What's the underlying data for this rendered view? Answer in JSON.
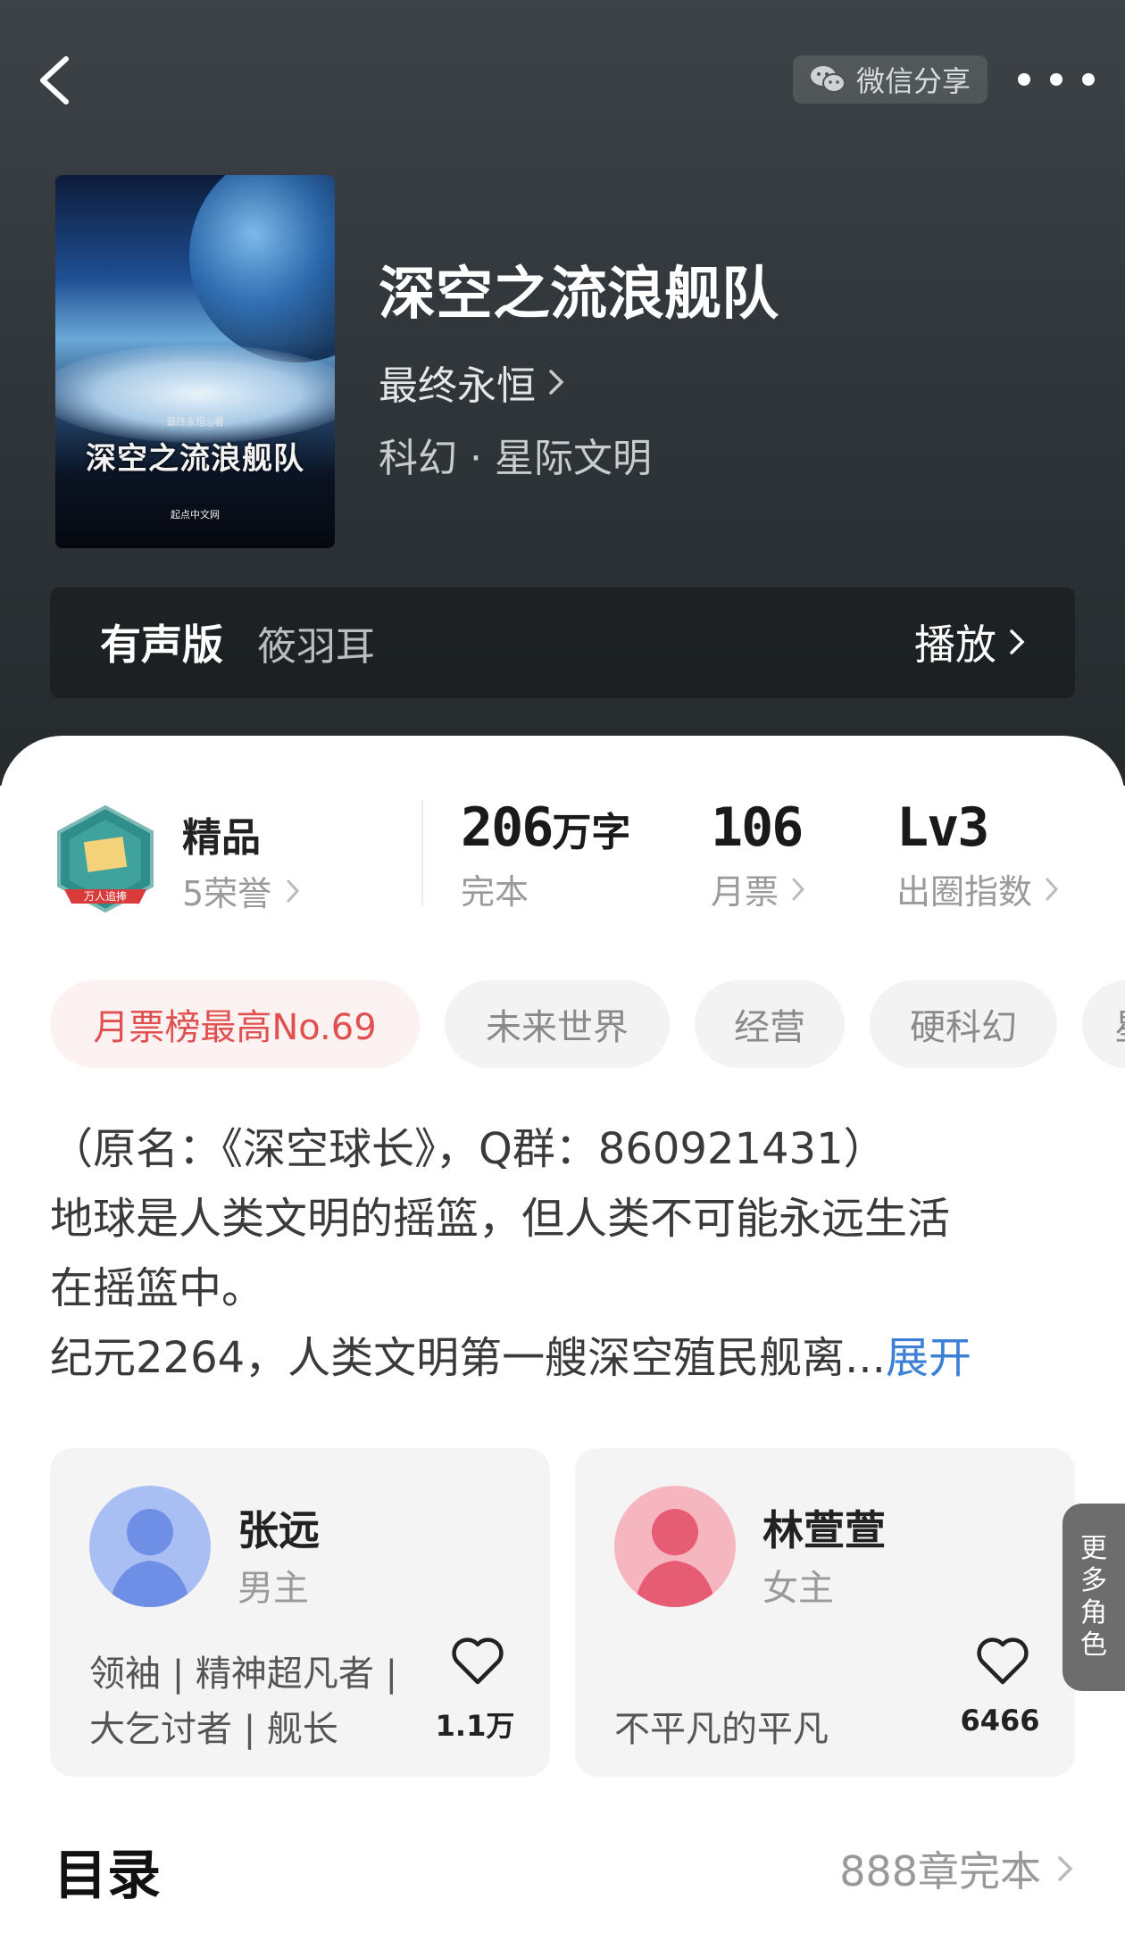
{
  "header": {
    "share_label": "微信分享",
    "icons": {
      "back": "back-arrow-icon",
      "wechat": "wechat-icon",
      "more": "more-icon"
    }
  },
  "book": {
    "title": "深空之流浪舰队",
    "author": "最终永恒",
    "genre": "科幻 · 星际文明",
    "cover_author": "最终永恒◎著",
    "cover_title": "深空之流浪舰队",
    "cover_publisher": "起点中文网"
  },
  "audio": {
    "label": "有声版",
    "narrator": "筱羽耳",
    "play_label": "播放"
  },
  "stats": {
    "quality": "精品",
    "honors": "5荣誉",
    "badge_text": "万人追捧",
    "words_num": "206",
    "words_unit": "万字",
    "status": "完本",
    "monthly_votes": "106",
    "monthly_votes_label": "月票",
    "level": "Lv3",
    "level_label": "出圈指数"
  },
  "tags": [
    "月票榜最高No.69",
    "未来世界",
    "经营",
    "硬科幻",
    "星"
  ],
  "description": {
    "line1": "（原名：《深空球长》，Q群：860921431）",
    "line2": "地球是人类文明的摇篮，但人类不可能永远生活",
    "line3": "在摇篮中。",
    "line4": "纪元2264，人类文明第一艘深空殖民舰离...",
    "expand": "展开"
  },
  "roles": [
    {
      "name": "张远",
      "type": "男主",
      "tags_line1": "领袖 | 精神超凡者 |",
      "tags_line2": "大乞讨者 | 舰长",
      "likes": "1.1万"
    },
    {
      "name": "林萱萱",
      "type": "女主",
      "tags_line1": "",
      "tags_line2": "不平凡的平凡",
      "likes": "6466"
    }
  ],
  "more_roles": [
    "更",
    "多",
    "角",
    "色"
  ],
  "toc": {
    "title": "目录",
    "summary": "888章完本"
  },
  "colors": {
    "accent_blue": "#3b7fd6",
    "rank_red": "#e05050",
    "header_bg": "#30363a"
  }
}
